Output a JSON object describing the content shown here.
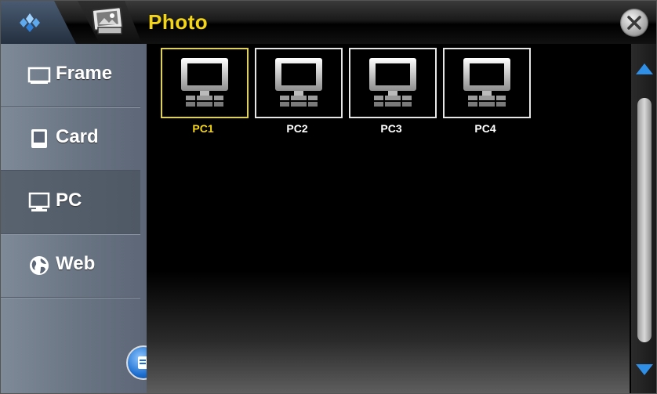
{
  "titlebar": {
    "title": "Photo",
    "home_icon": "home-diamond-icon",
    "app_icon": "photo-icon",
    "close_icon": "close-icon"
  },
  "sidebar": {
    "items": [
      {
        "label": "Frame",
        "icon": "frame-icon",
        "active": false
      },
      {
        "label": "Card",
        "icon": "card-icon",
        "active": false
      },
      {
        "label": "PC",
        "icon": "pc-icon",
        "active": true
      },
      {
        "label": "Web",
        "icon": "globe-icon",
        "active": false
      }
    ],
    "menu_icon": "menu-icon"
  },
  "main": {
    "items": [
      {
        "label": "PC1",
        "icon": "computer-icon",
        "selected": true
      },
      {
        "label": "PC2",
        "icon": "computer-icon",
        "selected": false
      },
      {
        "label": "PC3",
        "icon": "computer-icon",
        "selected": false
      },
      {
        "label": "PC4",
        "icon": "computer-icon",
        "selected": false
      }
    ]
  },
  "colors": {
    "accent": "#f3d417",
    "scroll_arrow": "#2f8fe6"
  }
}
